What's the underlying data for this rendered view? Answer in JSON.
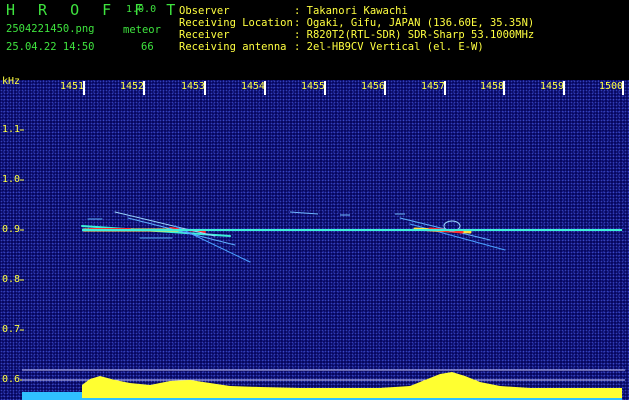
{
  "app": {
    "name": "H R O F F T",
    "version": "1.0.0"
  },
  "file": {
    "name": "2504221450.png",
    "datetime": "25.04.22 14:50"
  },
  "meteor": {
    "label": "meteor",
    "count": "66"
  },
  "station": {
    "rows": [
      {
        "label": "Observer",
        "value": ": Takanori Kawachi"
      },
      {
        "label": "Receiving Location",
        "value": ": Ogaki, Gifu, JAPAN (136.60E, 35.35N)"
      },
      {
        "label": "Receiver",
        "value": ": R820T2(RTL-SDR) SDR-Sharp 53.1000MHz"
      },
      {
        "label": "Receiving antenna",
        "value": ": 2el-HB9CV Vertical (el. E-W)"
      }
    ]
  },
  "axis": {
    "unit": "kHz",
    "time_ticks": [
      "1451",
      "1452",
      "1453",
      "1454",
      "1455",
      "1456",
      "1457",
      "1458",
      "1459",
      "1500"
    ],
    "freq_ticks": [
      "1.1",
      "1.0",
      "0.9",
      "0.8",
      "0.7",
      "0.6"
    ]
  },
  "colors": {
    "background": "#06065e",
    "carrier": "#3cf0d8",
    "echo_hot": "#ff3030",
    "level_bar": "#ffff30",
    "level_low": "#30c0ff"
  }
}
